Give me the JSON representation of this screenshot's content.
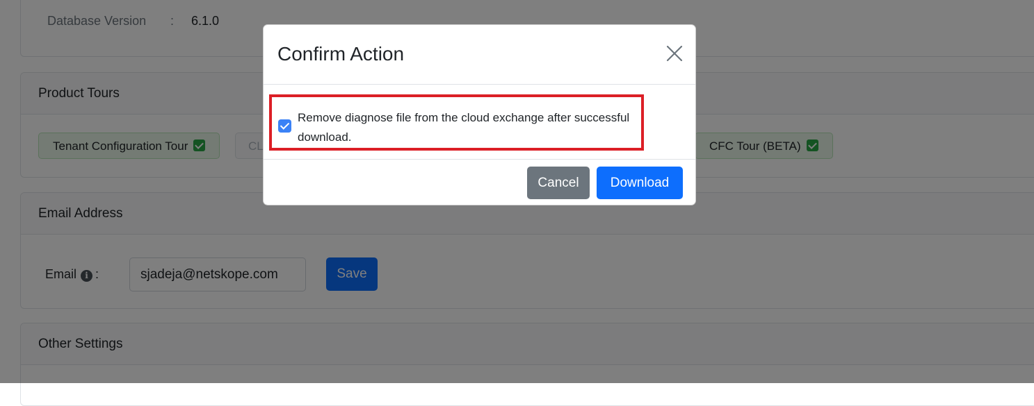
{
  "background": {
    "database": {
      "label": "Database Version",
      "separator": ":",
      "value": "6.1.0"
    },
    "product_tours": {
      "title": "Product Tours",
      "tours": [
        {
          "label": "Tenant Configuration Tour"
        },
        {
          "label": "CL"
        },
        {
          "label": "CFC Tour (BETA)"
        }
      ]
    },
    "email": {
      "title": "Email Address",
      "label": "Email",
      "separator": ":",
      "value": "sjadeja@netskope.com",
      "save_label": "Save"
    },
    "other_settings": {
      "title": "Other Settings"
    }
  },
  "modal": {
    "title": "Confirm Action",
    "checkbox_label": "Remove diagnose file from the cloud exchange after successful download.",
    "checkbox_checked": true,
    "cancel_label": "Cancel",
    "download_label": "Download"
  },
  "colors": {
    "primary": "#0d6efd",
    "secondary": "#6c757d",
    "highlight": "#dc1f26",
    "success": "#28a745"
  }
}
